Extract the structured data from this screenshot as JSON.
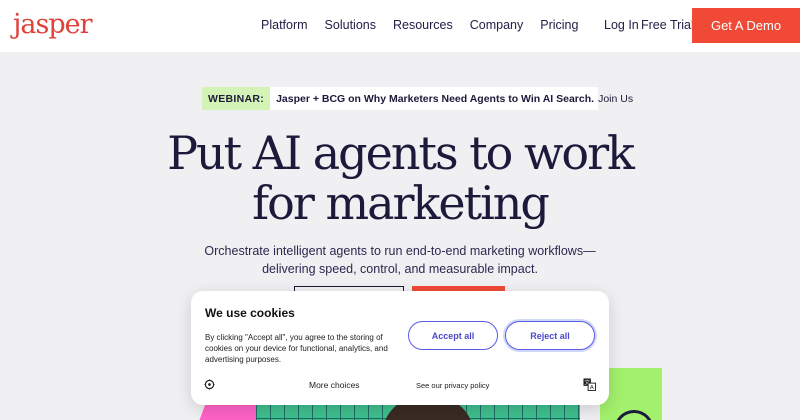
{
  "header": {
    "logo": "jasper",
    "nav": [
      "Platform",
      "Solutions",
      "Resources",
      "Company",
      "Pricing"
    ],
    "login": "Log In",
    "free_trial": "Free Trial",
    "demo": "Get A Demo"
  },
  "webinar": {
    "tag": "WEBINAR:",
    "text": "Jasper + BCG on Why Marketers Need Agents to Win AI Search.",
    "cta": "Join Us",
    "icon": "arrow-right-icon"
  },
  "hero": {
    "title_line1": "Put AI agents to work",
    "title_line2": "for marketing",
    "subtitle_line1": "Orchestrate intelligent agents to run end-to-end marketing workflows—",
    "subtitle_line2": "delivering speed, control, and measurable impact."
  },
  "cookie": {
    "title": "We use cookies",
    "description": "By clicking \"Accept all\", you agree to the storing of cookies on your device for functional, analytics, and advertising purposes.",
    "accept": "Accept all",
    "reject": "Reject all",
    "more_choices": "More choices",
    "privacy": "See our privacy policy",
    "settings_icon": "cookie-settings-icon",
    "translate_icon": "translate-icon"
  },
  "colors": {
    "brand": "#e0413a",
    "cta": "#f04a37",
    "webinar_tag": "#d3f4b6",
    "cookie_button": "#5a5ce8"
  }
}
